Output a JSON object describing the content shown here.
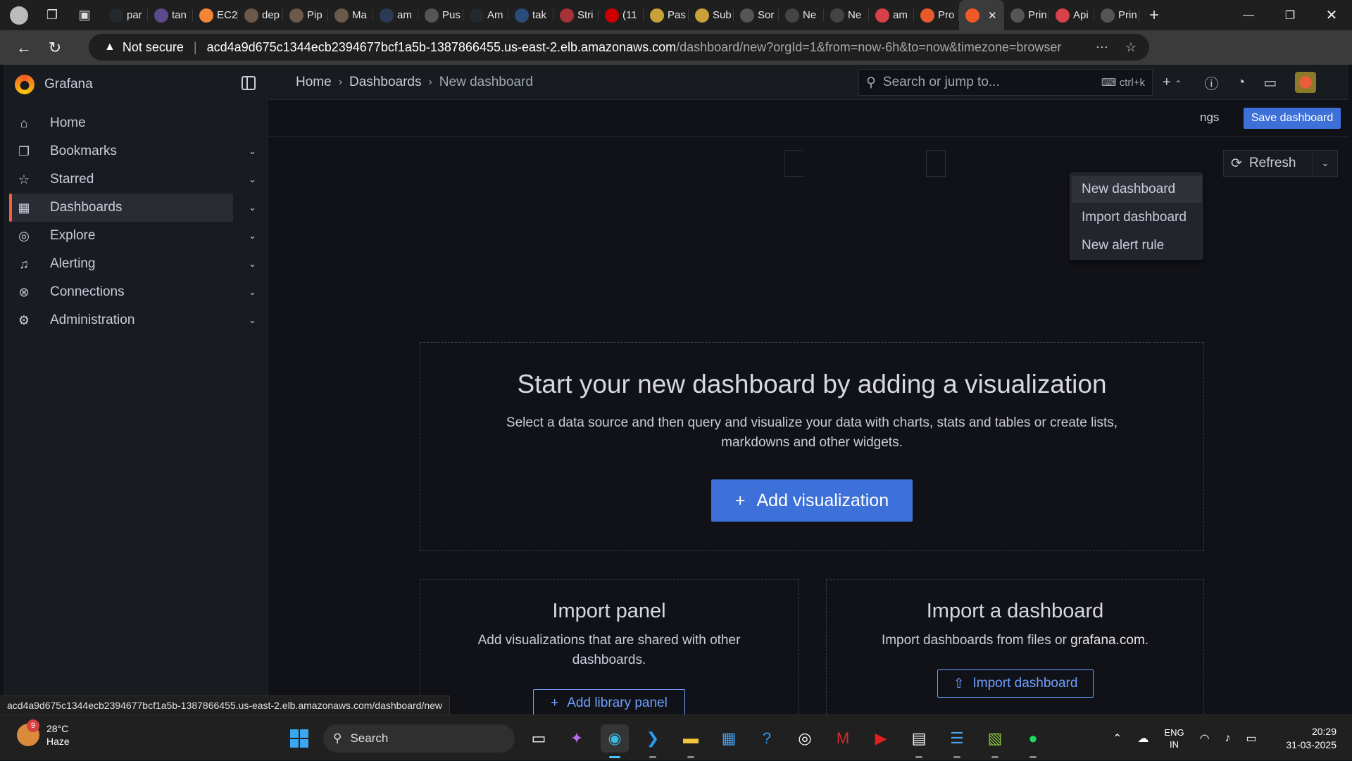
{
  "browser": {
    "tabs": [
      {
        "label": "par",
        "icon": "github-icon",
        "color": "#24292e"
      },
      {
        "label": "tan",
        "icon": "app-icon",
        "color": "#5b4b8a"
      },
      {
        "label": "EC2",
        "icon": "aws-icon",
        "color": "#f58536"
      },
      {
        "label": "dep",
        "icon": "avatar-icon",
        "color": "#6b5a4a"
      },
      {
        "label": "Pip",
        "icon": "avatar-icon",
        "color": "#6b5a4a"
      },
      {
        "label": "Ma",
        "icon": "avatar-icon",
        "color": "#6b5a4a"
      },
      {
        "label": "am",
        "icon": "swirl-icon",
        "color": "#2b3a55"
      },
      {
        "label": "Pus",
        "icon": "globe-icon",
        "color": "#555555"
      },
      {
        "label": "Am",
        "icon": "github-icon",
        "color": "#24292e"
      },
      {
        "label": "tak",
        "icon": "search-icon",
        "color": "#2b4c7a"
      },
      {
        "label": "Stri",
        "icon": "app-icon",
        "color": "#a8323a"
      },
      {
        "label": "(11",
        "icon": "youtube-icon",
        "color": "#cc0000"
      },
      {
        "label": "Pas",
        "icon": "app-icon",
        "color": "#c9a13a"
      },
      {
        "label": "Sub",
        "icon": "app-icon",
        "color": "#c9a13a"
      },
      {
        "label": "Sor",
        "icon": "globe-icon",
        "color": "#555555"
      },
      {
        "label": "Ne",
        "icon": "page-icon",
        "color": "#444444"
      },
      {
        "label": "Ne",
        "icon": "page-icon",
        "color": "#444444"
      },
      {
        "label": "am",
        "icon": "app-icon",
        "color": "#d8404a"
      },
      {
        "label": "Pro",
        "icon": "app-icon",
        "color": "#e85a2a"
      },
      {
        "label": "",
        "icon": "grafana-icon",
        "color": "#f05a28",
        "active": true
      },
      {
        "label": "Prin",
        "icon": "globe-icon",
        "color": "#555555"
      },
      {
        "label": "Api",
        "icon": "app-icon",
        "color": "#d8404a"
      },
      {
        "label": "Prin",
        "icon": "globe-icon",
        "color": "#555555"
      }
    ],
    "address": {
      "security": "Not secure",
      "host": "acd4a9d675c1344ecb2394677bcf1a5b-1387866455.us-east-2.elb.amazonaws.com",
      "path": "/dashboard/new?orgId=1&from=now-6h&to=now&timezone=browser"
    },
    "status_url": "acd4a9d675c1344ecb2394677bcf1a5b-1387866455.us-east-2.elb.amazonaws.com/dashboard/new"
  },
  "grafana": {
    "brand": "Grafana",
    "nav": [
      {
        "label": "Home",
        "icon": "home-icon",
        "expandable": false
      },
      {
        "label": "Bookmarks",
        "icon": "bookmark-icon",
        "expandable": true
      },
      {
        "label": "Starred",
        "icon": "star-icon",
        "expandable": true
      },
      {
        "label": "Dashboards",
        "icon": "apps-icon",
        "expandable": true,
        "active": true
      },
      {
        "label": "Explore",
        "icon": "compass-icon",
        "expandable": true
      },
      {
        "label": "Alerting",
        "icon": "bell-icon",
        "expandable": true
      },
      {
        "label": "Connections",
        "icon": "connections-icon",
        "expandable": true
      },
      {
        "label": "Administration",
        "icon": "cog-icon",
        "expandable": true
      }
    ],
    "breadcrumbs": [
      "Home",
      "Dashboards",
      "New dashboard"
    ],
    "search": {
      "placeholder": "Search or jump to...",
      "shortcut": "ctrl+k"
    },
    "toolbar": {
      "settings_partial": "ngs",
      "save_label": "Save dashboard",
      "refresh_label": "Refresh"
    },
    "new_menu": [
      "New dashboard",
      "Import dashboard",
      "New alert rule"
    ],
    "empty_state": {
      "title": "Start your new dashboard by adding a visualization",
      "description": "Select a data source and then query and visualize your data with charts, stats and tables or create lists, markdowns and other widgets.",
      "add_button": "Add visualization"
    },
    "import_panel": {
      "title": "Import panel",
      "description": "Add visualizations that are shared with other dashboards.",
      "button": "Add library panel"
    },
    "import_dashboard": {
      "title": "Import a dashboard",
      "description_prefix": "Import dashboards from files or ",
      "link": "grafana.com",
      "description_suffix": ".",
      "button": "Import dashboard"
    }
  },
  "taskbar": {
    "weather": {
      "temp": "28°C",
      "condition": "Haze",
      "badge": "9"
    },
    "search_label": "Search",
    "lang_top": "ENG",
    "lang_bottom": "IN",
    "time": "20:29",
    "date": "31-03-2025"
  }
}
